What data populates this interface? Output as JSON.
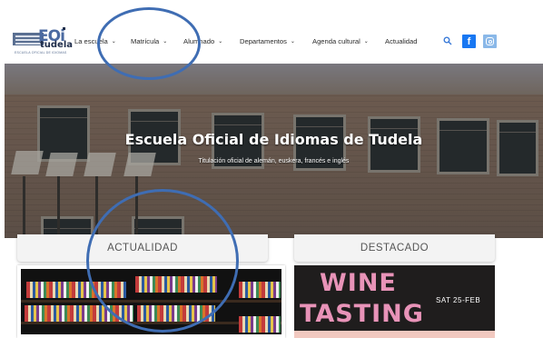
{
  "logo": {
    "mark": "EOi",
    "name": "tudela",
    "subtitle": "ESCUELA OFICIAL DE IDIOMAS"
  },
  "nav": {
    "items": [
      {
        "label": "La escuela",
        "dropdown": true
      },
      {
        "label": "Matrícula",
        "dropdown": true
      },
      {
        "label": "Alumnado",
        "dropdown": true
      },
      {
        "label": "Departamentos",
        "dropdown": true
      },
      {
        "label": "Agenda cultural",
        "dropdown": true
      },
      {
        "label": "Actualidad",
        "dropdown": false
      }
    ],
    "icons": [
      "search-icon",
      "facebook-icon",
      "instagram-icon"
    ],
    "facebook_glyph": "f"
  },
  "hero": {
    "title": "Escuela Oficial de Idiomas de Tudela",
    "subtitle": "Titulación oficial de alemán, euskera, francés e inglés"
  },
  "sections": {
    "left_tab": "ACTUALIDAD",
    "right_tab": "DESTACADO"
  },
  "featured": {
    "line1": "WINE",
    "line2": "TASTING",
    "date": "SAT 25-FEB"
  },
  "colors": {
    "accent": "#1877f2",
    "annotation": "#3f6db3",
    "wine_pink": "#e893b8"
  }
}
